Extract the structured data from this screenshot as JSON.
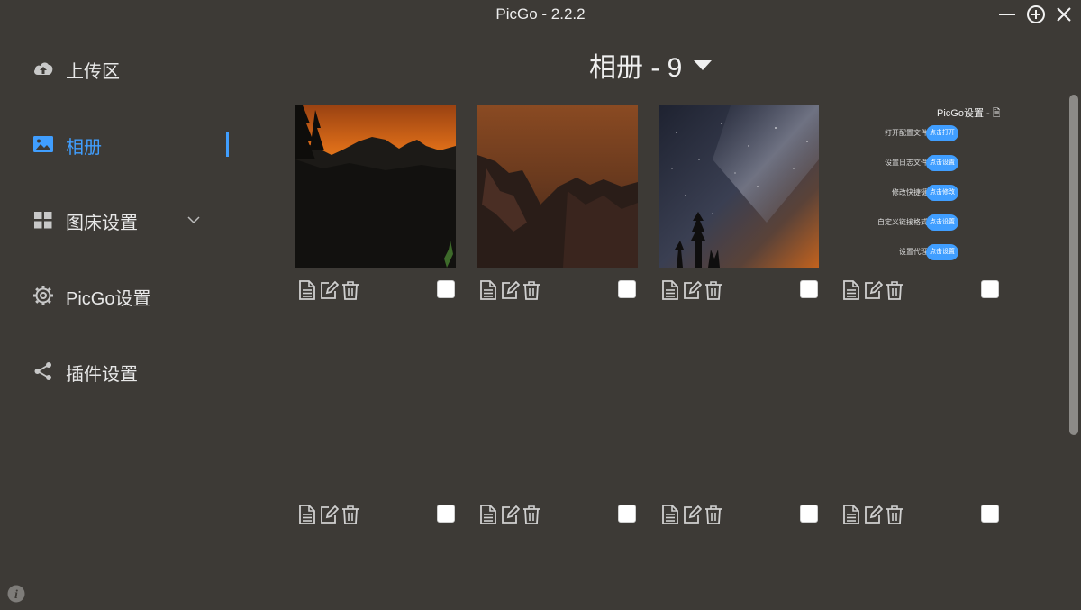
{
  "app": {
    "title": "PicGo - 2.2.2"
  },
  "window_controls": {
    "minimize_icon": "minus-icon",
    "maximize_icon": "plus-circle-icon",
    "close_icon": "close-icon"
  },
  "sidebar": {
    "items": [
      {
        "label": "上传区",
        "icon": "cloud-upload-icon",
        "active": false
      },
      {
        "label": "相册",
        "icon": "image-icon",
        "active": true
      },
      {
        "label": "图床设置",
        "icon": "grid-icon",
        "active": false,
        "expandable": true
      },
      {
        "label": "PicGo设置",
        "icon": "gear-icon",
        "active": false
      },
      {
        "label": "插件设置",
        "icon": "share-icon",
        "active": false
      }
    ],
    "info_icon": "info-icon"
  },
  "gallery": {
    "title": "相册 - 9",
    "count": 9,
    "dropdown_icon": "caret-down-icon",
    "images": [
      {
        "type": "photo",
        "description_icon": "sunset-mountain-image"
      },
      {
        "type": "photo",
        "description_icon": "dusk-cliff-image"
      },
      {
        "type": "photo",
        "description_icon": "starry-night-image"
      },
      {
        "type": "screenshot",
        "title": "PicGo设置 - 🗎",
        "rows": [
          {
            "label": "打开配置文件",
            "button": "点击打开"
          },
          {
            "label": "设置日志文件",
            "button": "点击设置"
          },
          {
            "label": "修改快捷键",
            "button": "点击修改"
          },
          {
            "label": "自定义链接格式",
            "button": "点击设置"
          },
          {
            "label": "设置代理",
            "button": "点击设置"
          }
        ]
      },
      {
        "type": "empty"
      },
      {
        "type": "empty"
      },
      {
        "type": "empty"
      },
      {
        "type": "empty"
      }
    ],
    "action_icons": [
      "copy-link-icon",
      "edit-icon",
      "delete-icon"
    ]
  },
  "colors": {
    "background": "#3d3a36",
    "accent": "#409eff",
    "text": "#eeeeee"
  }
}
